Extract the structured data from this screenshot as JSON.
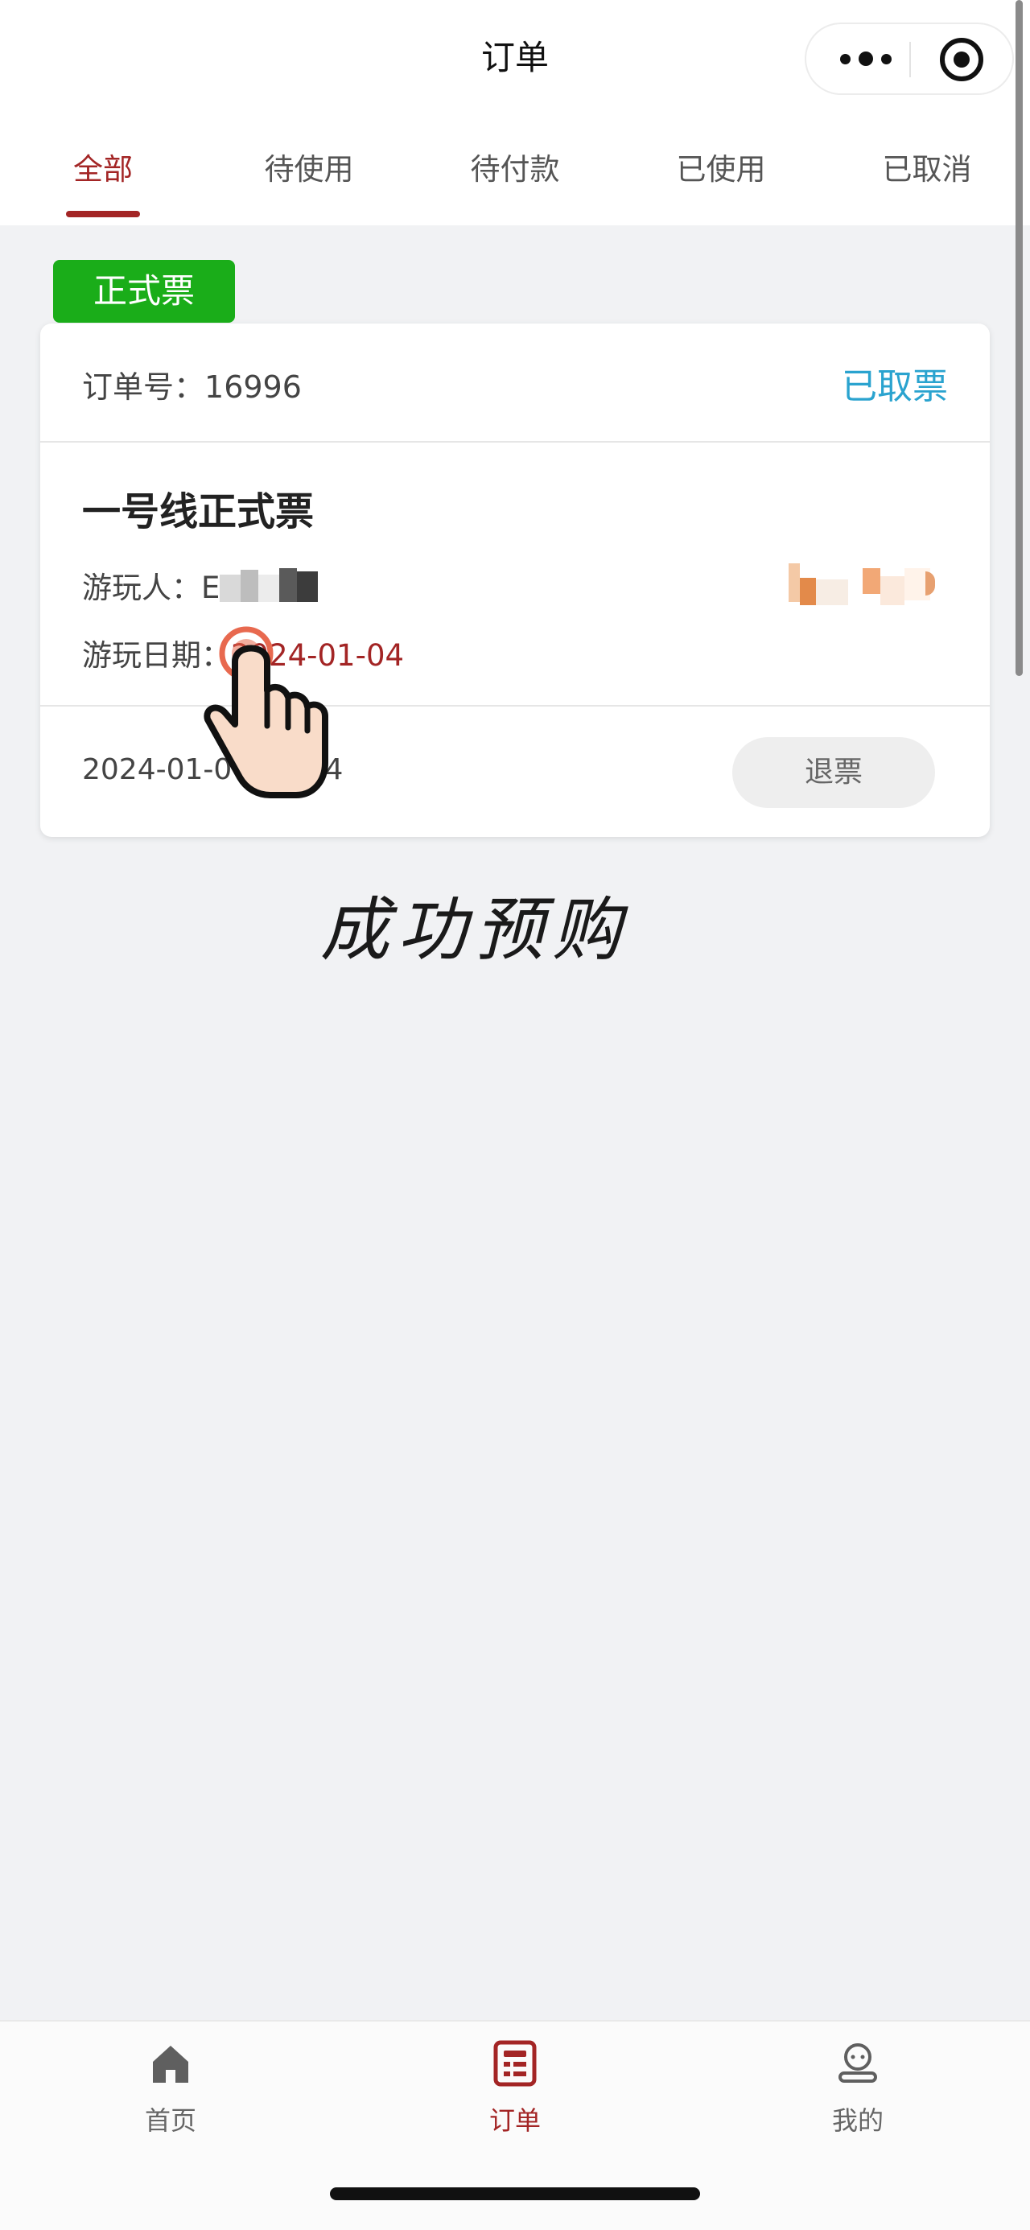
{
  "header": {
    "title": "订单"
  },
  "tabs": [
    {
      "label": "全部",
      "active": true
    },
    {
      "label": "待使用",
      "active": false
    },
    {
      "label": "待付款",
      "active": false
    },
    {
      "label": "已使用",
      "active": false
    },
    {
      "label": "已取消",
      "active": false
    }
  ],
  "order": {
    "badge": "正式票",
    "order_no_label": "订单号：",
    "order_no": "16996",
    "status": "已取票",
    "ticket_name": "一号线正式票",
    "visitor_label": "游玩人：",
    "visitor_name_visible": "E",
    "play_date_label": "游玩日期：",
    "play_date": "2024-01-04",
    "created_at_visible": "2024-01-0     3:14",
    "refund_button": "退票"
  },
  "caption": "成功预购",
  "bottom_nav": [
    {
      "label": "首页",
      "icon": "home-icon",
      "active": false
    },
    {
      "label": "订单",
      "icon": "order-icon",
      "active": true
    },
    {
      "label": "我的",
      "icon": "profile-icon",
      "active": false
    }
  ],
  "colors": {
    "accent": "#a32525",
    "badge": "#1aad19",
    "status": "#2aa3cf",
    "page_bg": "#f1f2f4"
  }
}
